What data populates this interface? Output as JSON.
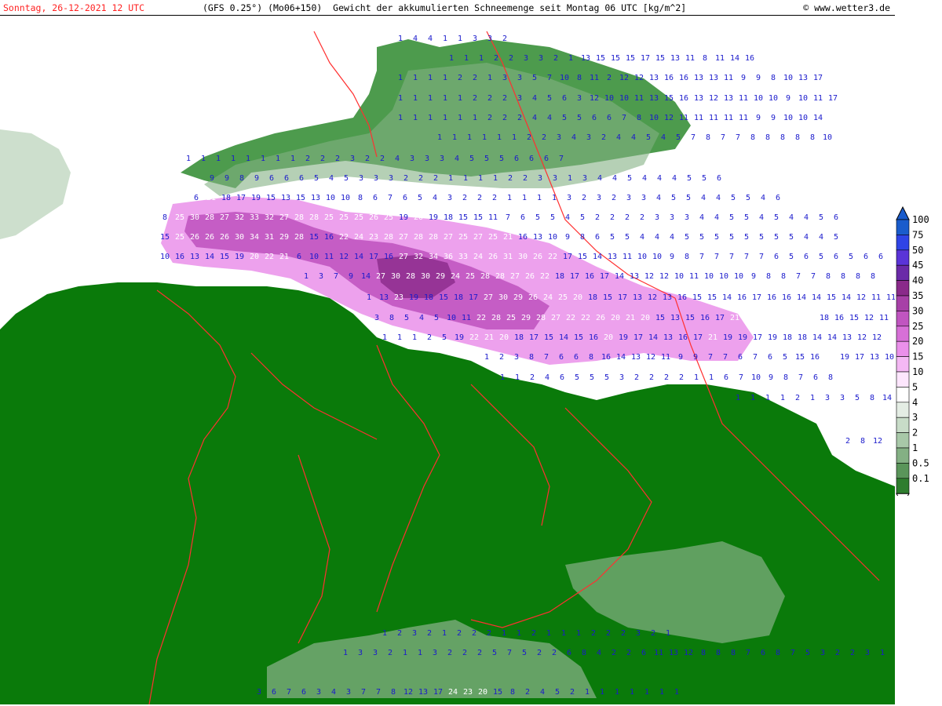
{
  "header": {
    "date_label": "Sonntag, 26-12-2021  12 UTC",
    "model_label": "(GFS 0.25°) (Mo06+150)  Gewicht der akkumulierten Schneemenge seit Montag 06 UTC [kg/m^2]",
    "credit_label": "www.wetter3.de"
  },
  "map": {
    "variable": "Gewicht der akkumulierten Schneemenge",
    "unit": "kg/m^2",
    "base_color": "#0a7a0a",
    "border_color": "#ff3030",
    "value_text_color": "#1a1acc",
    "grid_rows": [
      {
        "values": [
          1,
          4,
          4,
          1,
          1,
          3,
          3,
          2
        ]
      },
      {
        "values": [
          1,
          1,
          1,
          2,
          2,
          3,
          3,
          2,
          1,
          13,
          15,
          15,
          15,
          17,
          15,
          13,
          11,
          8,
          11,
          14,
          16
        ]
      },
      {
        "values": [
          1,
          1,
          1,
          1,
          2,
          2,
          1,
          3,
          3,
          5,
          7,
          10,
          8,
          11,
          2,
          12,
          12,
          13,
          16,
          16,
          13,
          13,
          11,
          9,
          9,
          8,
          10,
          13,
          17
        ]
      },
      {
        "values": [
          1,
          1,
          1,
          1,
          1,
          2,
          2,
          2,
          3,
          4,
          5,
          6,
          3,
          12,
          10,
          10,
          11,
          13,
          15,
          16,
          13,
          12,
          13,
          11,
          10,
          10,
          9,
          10,
          11,
          17
        ]
      },
      {
        "values": [
          1,
          1,
          1,
          1,
          1,
          1,
          2,
          2,
          2,
          4,
          4,
          5,
          5,
          6,
          6,
          7,
          8,
          10,
          12,
          11,
          11,
          11,
          11,
          11,
          9,
          9,
          10,
          10,
          14
        ]
      },
      {
        "values": [
          1,
          1,
          1,
          1,
          1,
          1,
          2,
          2,
          3,
          4,
          3,
          2,
          4,
          4,
          5,
          4,
          5,
          7,
          8,
          7,
          7,
          8,
          8,
          8,
          8,
          8,
          10
        ]
      },
      {
        "values": [
          1,
          1,
          1,
          1,
          1,
          1,
          1,
          1,
          2,
          2,
          2,
          3,
          2,
          2,
          4,
          3,
          3,
          3,
          4,
          5,
          5,
          5,
          6,
          6,
          6,
          7
        ]
      },
      {
        "values": [
          9,
          9,
          8,
          9,
          6,
          6,
          6,
          5,
          4,
          5,
          3,
          3,
          3,
          2,
          2,
          2,
          1,
          1,
          1,
          1,
          2,
          2,
          3,
          3,
          1,
          3,
          4,
          4,
          5,
          4,
          4,
          4,
          5,
          5,
          6
        ]
      },
      {
        "values": [
          6,
          21,
          18,
          17,
          19,
          15,
          13,
          15,
          13,
          10,
          10,
          8,
          6,
          7,
          6,
          5,
          4,
          3,
          2,
          2,
          2,
          1,
          1,
          1,
          1,
          3,
          2,
          3,
          2,
          3,
          3,
          4,
          5,
          5,
          4,
          4,
          5,
          5,
          4,
          6
        ]
      },
      {
        "values": [
          8,
          25,
          30,
          28,
          27,
          32,
          33,
          32,
          27,
          28,
          28,
          25,
          25,
          25,
          26,
          25,
          19,
          20,
          19,
          18,
          15,
          15,
          11,
          7,
          6,
          5,
          5,
          4,
          5,
          2,
          2,
          2,
          2,
          3,
          3,
          3,
          4,
          4,
          5,
          5,
          4,
          5,
          4,
          4,
          5,
          6
        ]
      },
      {
        "values": [
          15,
          25,
          26,
          26,
          26,
          30,
          34,
          31,
          29,
          28,
          15,
          16,
          22,
          24,
          23,
          28,
          27,
          28,
          28,
          27,
          25,
          27,
          25,
          21,
          16,
          13,
          10,
          9,
          8,
          6,
          5,
          5,
          4,
          4,
          4,
          5,
          5,
          5,
          5,
          5,
          5,
          5,
          5,
          4,
          4,
          5
        ]
      },
      {
        "values": [
          10,
          16,
          13,
          14,
          15,
          19,
          20,
          22,
          21,
          6,
          10,
          11,
          12,
          14,
          17,
          16,
          27,
          32,
          34,
          36,
          33,
          24,
          26,
          31,
          30,
          26,
          22,
          17,
          15,
          14,
          13,
          11,
          10,
          10,
          9,
          8,
          7,
          7,
          7,
          7,
          7,
          6,
          5,
          6,
          5,
          6,
          5,
          6,
          6,
          6
        ]
      },
      {
        "values": [
          1,
          3,
          7,
          9,
          14,
          27,
          30,
          28,
          30,
          29,
          24,
          25,
          28,
          28,
          27,
          26,
          22,
          18,
          17,
          16,
          17,
          14,
          13,
          12,
          12,
          10,
          11,
          10,
          10,
          10,
          9,
          8,
          8,
          7,
          7,
          8,
          8,
          8,
          8
        ]
      },
      {
        "values": [
          1,
          13,
          23,
          19,
          18,
          15,
          18,
          17,
          27,
          30,
          29,
          26,
          24,
          25,
          20,
          18,
          15,
          17,
          13,
          12,
          13,
          16,
          15,
          15,
          14,
          16,
          17,
          16,
          16,
          14,
          14,
          15,
          14,
          12,
          11,
          11,
          11,
          10,
          10
        ]
      },
      {
        "values": [
          3,
          8,
          5,
          4,
          5,
          10,
          11,
          22,
          28,
          25,
          29,
          28,
          27,
          22,
          22,
          26,
          20,
          21,
          20,
          15,
          13,
          15,
          16,
          17,
          21,
          27,
          25,
          24,
          21,
          20,
          18,
          16,
          15,
          12,
          11,
          12,
          11,
          11
        ]
      },
      {
        "values": [
          1,
          1,
          1,
          2,
          5,
          19,
          22,
          21,
          20,
          18,
          17,
          15,
          14,
          15,
          16,
          20,
          19,
          17,
          14,
          13,
          16,
          17,
          21,
          19,
          19,
          17,
          19,
          18,
          18,
          14,
          14,
          13,
          12,
          12,
          12
        ]
      },
      {
        "values": [
          1,
          2,
          3,
          8,
          7,
          6,
          6,
          8,
          16,
          14,
          13,
          12,
          11,
          9,
          9,
          7,
          7,
          6,
          7,
          6,
          5,
          15,
          16,
          21,
          19,
          17,
          13,
          10,
          9,
          9
        ]
      },
      {
        "values": [
          1,
          1,
          2,
          4,
          6,
          5,
          5,
          5,
          3,
          2,
          2,
          2,
          2,
          1,
          1,
          6,
          7,
          10,
          9,
          8,
          7,
          6,
          8
        ]
      },
      {
        "values": [
          1,
          1,
          1,
          1,
          2,
          1,
          3,
          3,
          5,
          8,
          14
        ]
      },
      {
        "values": [
          2,
          8,
          12,
          2,
          4,
          5,
          1,
          2
        ]
      },
      {
        "values": [
          1,
          2,
          3,
          2,
          1,
          2,
          2,
          2,
          1,
          1,
          2,
          1,
          1,
          1,
          2,
          2,
          2,
          3,
          2,
          1
        ]
      },
      {
        "values": [
          1,
          3,
          3,
          2,
          1,
          1,
          3,
          2,
          2,
          2,
          5,
          7,
          5,
          2,
          2,
          6,
          8,
          4,
          2,
          2,
          6,
          11,
          13,
          12,
          8,
          8,
          8,
          7,
          6,
          8,
          7,
          5,
          3,
          2,
          2,
          3,
          1
        ]
      },
      {
        "values": [
          3,
          6,
          7,
          6,
          3,
          4,
          3,
          7,
          7,
          8,
          12,
          13,
          17,
          24,
          23,
          20,
          15,
          8,
          2,
          4,
          5,
          2,
          1,
          1,
          1,
          1,
          1,
          1,
          1
        ]
      }
    ]
  },
  "legend": {
    "labels": [
      "100",
      "75",
      "50",
      "45",
      "40",
      "35",
      "30",
      "25",
      "20",
      "15",
      "10",
      "5",
      "4",
      "3",
      "2",
      "1",
      "0.5",
      "0.1"
    ],
    "colors": [
      "#1a5ccc",
      "#2f44e6",
      "#5a34d8",
      "#6a2aa8",
      "#8a2a8a",
      "#a740a7",
      "#c055c0",
      "#d770d7",
      "#ea90ea",
      "#f4b8f4",
      "#fde6fd",
      "#ffffff",
      "#e4ede4",
      "#c8dcc8",
      "#a8c8a8",
      "#84b084",
      "#5a955a",
      "#2e7d2e"
    ]
  }
}
